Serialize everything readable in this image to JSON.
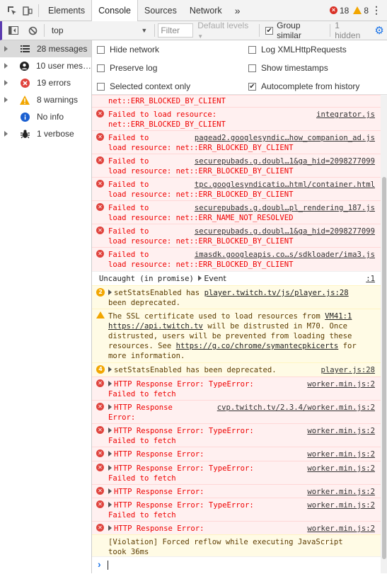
{
  "toolbar": {
    "tabs": [
      "Elements",
      "Console",
      "Sources",
      "Network"
    ],
    "more": "»",
    "error_count": "18",
    "warning_count": "8",
    "menu": "⋮"
  },
  "filterbar": {
    "context": "top",
    "filter_placeholder": "Filter",
    "levels": "Default levels",
    "group_similar": "Group similar",
    "hidden": "1 hidden"
  },
  "sidebar": {
    "items": [
      {
        "label": "28 messages"
      },
      {
        "label": "10 user mes…"
      },
      {
        "label": "19 errors"
      },
      {
        "label": "8 warnings"
      },
      {
        "label": "No info"
      },
      {
        "label": "1 verbose"
      }
    ]
  },
  "settings": {
    "hide_network": "Hide network",
    "preserve_log": "Preserve log",
    "selected_context": "Selected context only",
    "log_xhr": "Log XMLHttpRequests",
    "show_timestamps": "Show timestamps",
    "autocomplete": "Autocomplete from history"
  },
  "messages": [
    {
      "type": "error",
      "l1": "net::ERR_BLOCKED_BY_CLIENT",
      "l2": "",
      "src": ""
    },
    {
      "type": "error",
      "l1": "Failed to load resource:",
      "l2": "net::ERR_BLOCKED_BY_CLIENT",
      "src": "integrator.js"
    },
    {
      "type": "error",
      "l1": "Failed to",
      "l2": "load resource: net::ERR_BLOCKED_BY_CLIENT",
      "src": "pagead2.googlesyndic…how_companion_ad.js"
    },
    {
      "type": "error",
      "l1": "Failed to",
      "l2": "load resource: net::ERR_BLOCKED_BY_CLIENT",
      "src": "securepubads.g.doubl…1&ga_hid=2098277099"
    },
    {
      "type": "error",
      "l1": "Failed to",
      "l2": "load resource: net::ERR_BLOCKED_BY_CLIENT",
      "src": "tpc.googlesyndicatio…html/container.html"
    },
    {
      "type": "error",
      "l1": "Failed to",
      "l2": "load resource: net::ERR_NAME_NOT_RESOLVED",
      "src": "securepubads.g.doubl…pl_rendering_187.js"
    },
    {
      "type": "error",
      "l1": "Failed to",
      "l2": "load resource: net::ERR_BLOCKED_BY_CLIENT",
      "src": "securepubads.g.doubl…1&ga_hid=2098277099"
    },
    {
      "type": "error",
      "l1": "Failed to",
      "l2": "load resource: net::ERR_BLOCKED_BY_CLIENT",
      "src": "imasdk.googleapis.co…s/sdkloader/ima3.js"
    },
    {
      "type": "info",
      "l1": "Uncaught (in promise) ",
      "event": "Event",
      "src": ":1"
    },
    {
      "type": "warning",
      "count": "2",
      "l1": "setStatsEnabled has ",
      "link": "player.twitch.tv/js/player.js:28",
      "l2": "been deprecated."
    },
    {
      "type": "ssl",
      "l1a": "The SSL certificate used to load resources from ",
      "l1link": "VM41:1",
      "l2link": "https://api.twitch.tv",
      "l2": " will be distrusted in M70. Once",
      "l3": "distrusted, users will be prevented from loading these",
      "l4a": "resources. See ",
      "l4link": "https://g.co/chrome/symantecpkicerts",
      "l4b": " for",
      "l5": "more information."
    },
    {
      "type": "warning2",
      "count": "4",
      "l1": "setStatsEnabled has been deprecated.",
      "src": "player.js:28"
    },
    {
      "type": "error",
      "tri": true,
      "l1": "HTTP Response Error: TypeError:",
      "l2": "Failed to fetch",
      "src": "worker.min.js:2"
    },
    {
      "type": "error",
      "tri": true,
      "l1": "HTTP Response",
      "l2": "Error:",
      "src": "cvp.twitch.tv/2.3.4/worker.min.js:2"
    },
    {
      "type": "error",
      "tri": true,
      "l1": "HTTP Response Error: TypeError:",
      "l2": "Failed to fetch",
      "src": "worker.min.js:2"
    },
    {
      "type": "error",
      "tri": true,
      "l1": "HTTP Response Error:",
      "l2": "",
      "src": "worker.min.js:2"
    },
    {
      "type": "error",
      "tri": true,
      "l1": "HTTP Response Error: TypeError:",
      "l2": "Failed to fetch",
      "src": "worker.min.js:2"
    },
    {
      "type": "error",
      "tri": true,
      "l1": "HTTP Response Error:",
      "l2": "",
      "src": "worker.min.js:2"
    },
    {
      "type": "error",
      "tri": true,
      "l1": "HTTP Response Error: TypeError:",
      "l2": "Failed to fetch",
      "src": "worker.min.js:2"
    },
    {
      "type": "error",
      "tri": true,
      "l1": "HTTP Response Error:",
      "l2": "",
      "src": "worker.min.js:2"
    },
    {
      "type": "violation",
      "l1": "[Violation] Forced reflow while executing JavaScript",
      "l2": "took 36ms"
    }
  ],
  "prompt": "›"
}
